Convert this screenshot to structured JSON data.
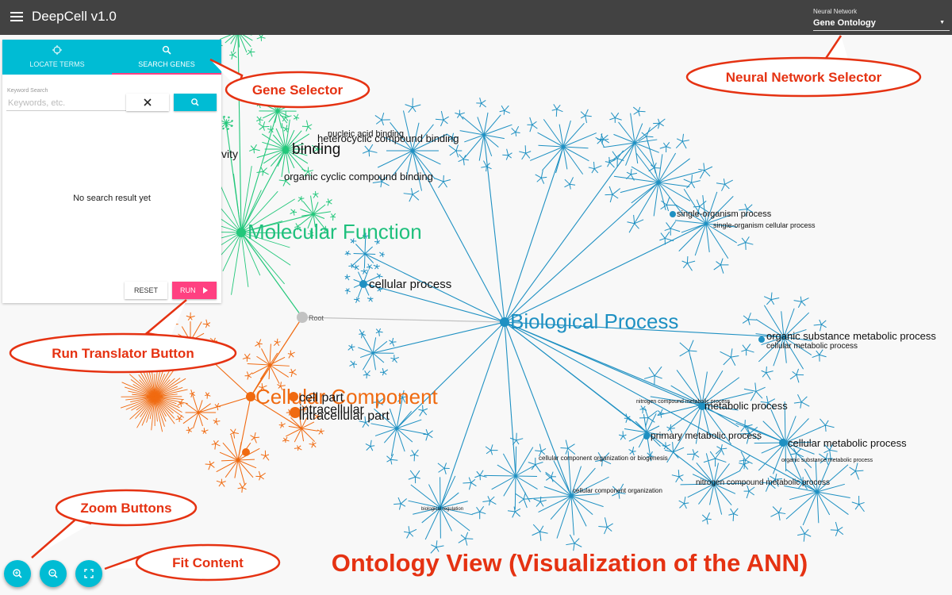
{
  "app": {
    "title": "DeepCell v1.0"
  },
  "network_selector": {
    "label": "Neural Network",
    "value": "Gene Ontology"
  },
  "panel": {
    "tabs": [
      {
        "label": "LOCATE TERMS"
      },
      {
        "label": "SEARCH GENES"
      }
    ],
    "keyword_label": "Keyword Search",
    "keyword_placeholder": "Keywords, etc.",
    "no_result": "No search result yet",
    "reset_label": "RESET",
    "run_label": "RUN"
  },
  "graph": {
    "root": "Root",
    "labels": {
      "biological_process": "Biological Process",
      "molecular_function": "Molecular Function",
      "cellular_component": "Cellular Component",
      "binding": "binding",
      "heterocyclic_compound_binding": "heterocyclic compound binding",
      "nucleic_acid_binding": "nucleic acid binding",
      "organic_cyclic_compound_binding": "organic cyclic compound binding",
      "activity_fragment": "vity",
      "cellular_process": "cellular process",
      "single_organism_process": "single-organism process",
      "single_organism_cellular_process": "single-organism cellular process",
      "organic_substance_metabolic_process": "organic substance metabolic process",
      "metabolic_process": "metabolic process",
      "primary_metabolic_process": "primary metabolic process",
      "cellular_metabolic_process": "cellular metabolic process",
      "cc_organization_biogenesis": "cellular component organization or biogenesis",
      "cc_organization": "cellular component organization",
      "biological_regulation": "biological regulation",
      "nitrogen_compound_metabolic_process": "nitrogen compound metabolic process",
      "cell_part": "cell part",
      "intracellular": "intracellular",
      "intracellular_part": "intracellular part"
    }
  },
  "callouts": {
    "gene_selector": "Gene Selector",
    "nn_selector": "Neural Network Selector",
    "run_button": "Run Translator Button",
    "zoom_buttons": "Zoom Buttons",
    "fit_content": "Fit Content",
    "ontology_view": "Ontology View (Visualization of the ANN)"
  },
  "icons": {
    "menu": "menu-icon",
    "locate": "crosshair-icon",
    "search": "search-icon",
    "clear": "close-icon",
    "run": "play-icon",
    "zoom_in": "zoom-in-icon",
    "zoom_out": "zoom-out-icon",
    "fit": "fit-screen-icon",
    "dropdown": "caret-down-icon"
  },
  "colors": {
    "appbar": "#424242",
    "accent_cyan": "#00bcd4",
    "accent_pink": "#ff4081",
    "biological_process": "#1e90c2",
    "molecular_function": "#22c77a",
    "cellular_component": "#f06a10",
    "root": "#c2c2c2",
    "callout_red": "#e53212"
  }
}
